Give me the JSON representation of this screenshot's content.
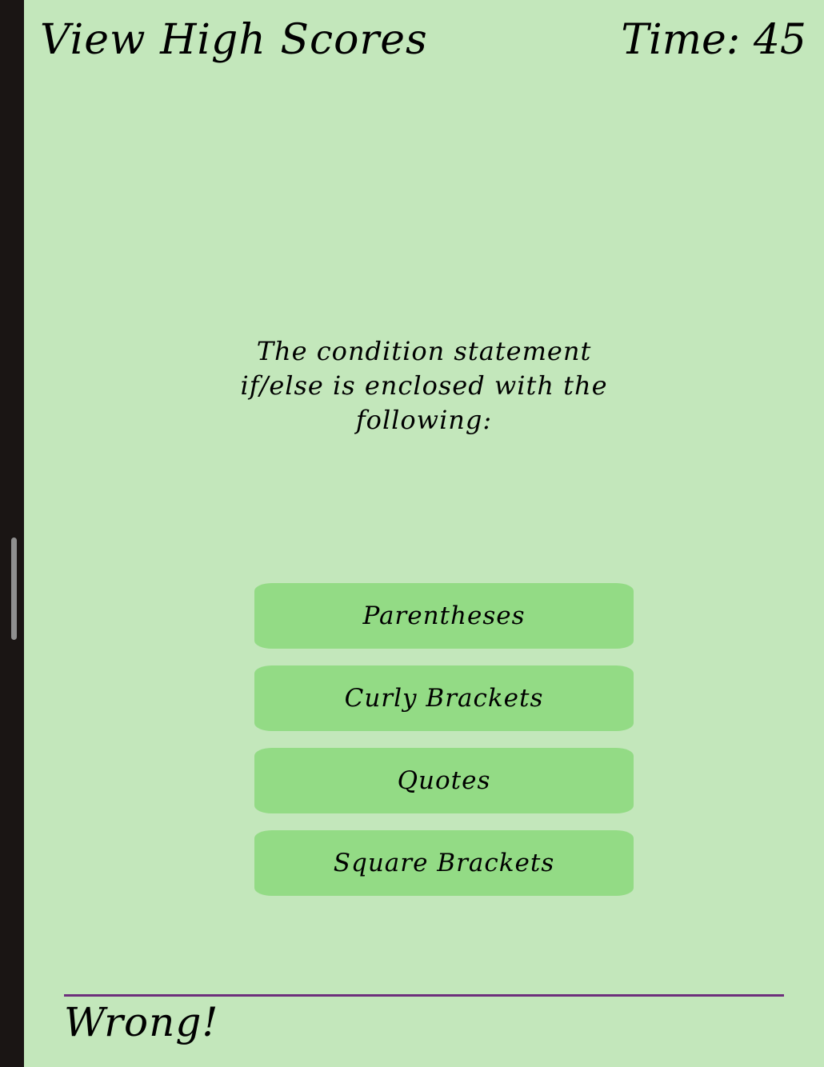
{
  "header": {
    "high_scores_label": "View High Scores",
    "timer_text": "Time: 45"
  },
  "quiz": {
    "question": "The condition statement if/else is enclosed with the following:",
    "choices": [
      {
        "label": "Parentheses"
      },
      {
        "label": "Curly Brackets"
      },
      {
        "label": "Quotes"
      },
      {
        "label": "Square Brackets"
      }
    ]
  },
  "feedback": {
    "result": "Wrong!"
  },
  "colors": {
    "background": "#c3e7bb",
    "button": "#93db85",
    "divider": "#6d2f7b"
  }
}
